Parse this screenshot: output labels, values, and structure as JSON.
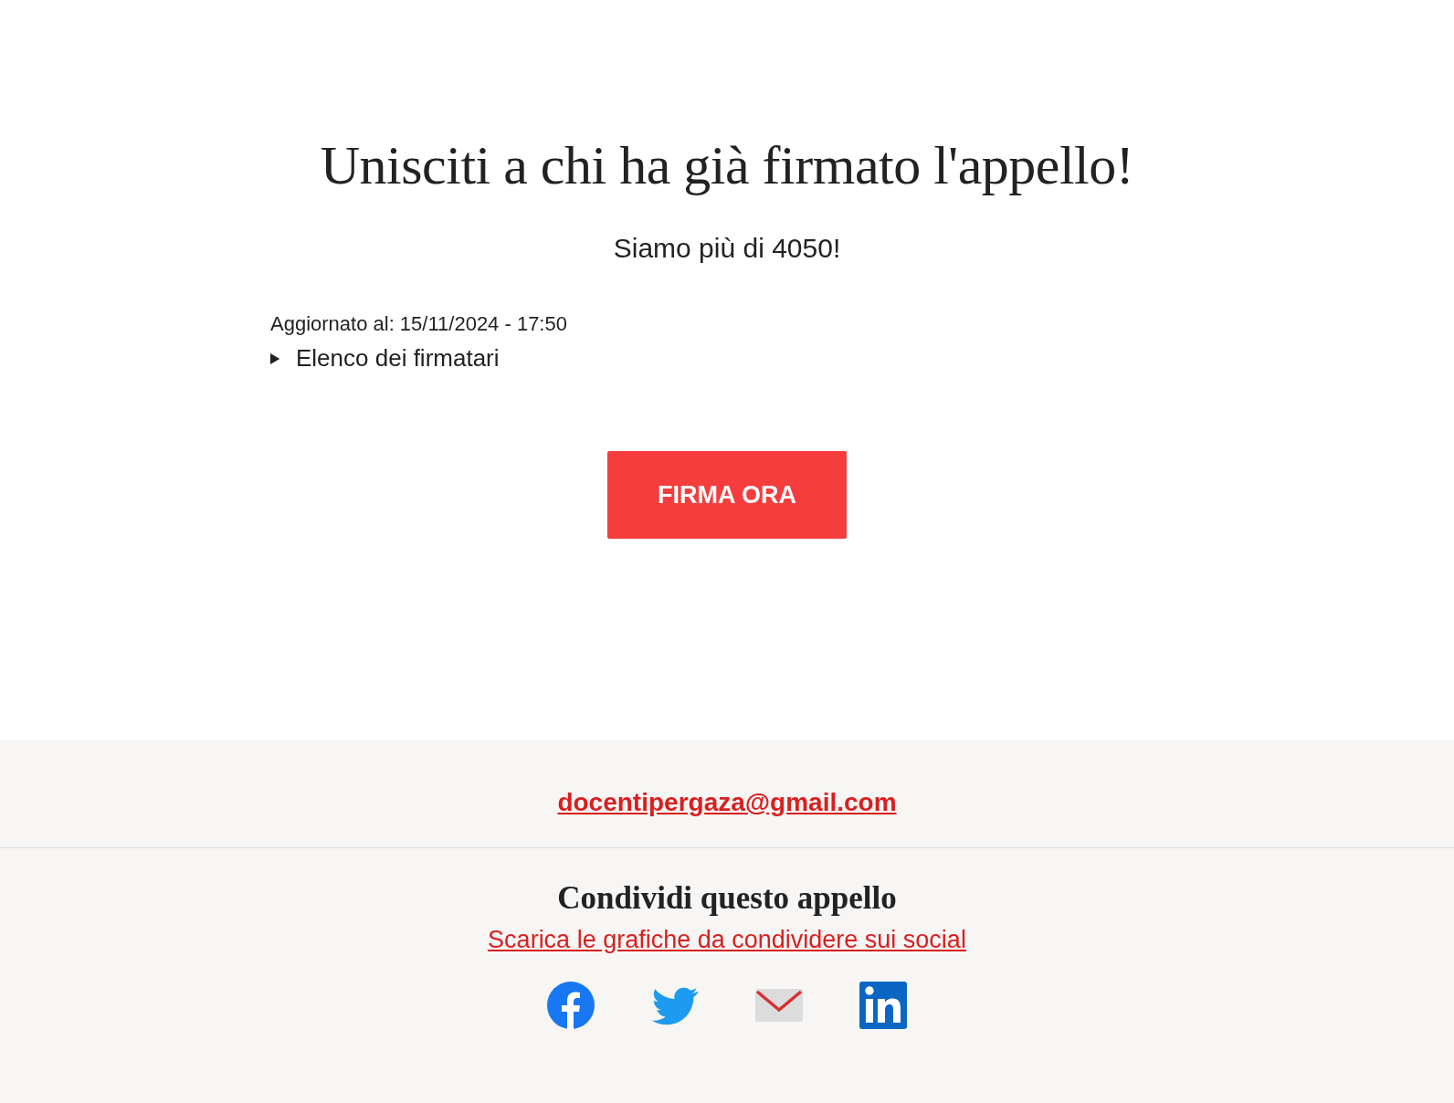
{
  "heading": "Unisciti a chi ha già firmato l'appello!",
  "count_text": "Siamo più di 4050!",
  "updated": "Aggiornato al: 15/11/2024 - 17:50",
  "signers": {
    "label": "Elenco dei firmatari",
    "expanded": false
  },
  "sign_button": "FIRMA ORA",
  "footer": {
    "email": "docentipergaza@gmail.com",
    "share_title": "Condividi questo appello",
    "download_link": "Scarica le grafiche da condividere sui social",
    "social": [
      {
        "kind": "facebook"
      },
      {
        "kind": "twitter"
      },
      {
        "kind": "email"
      },
      {
        "kind": "linkedin"
      }
    ]
  }
}
